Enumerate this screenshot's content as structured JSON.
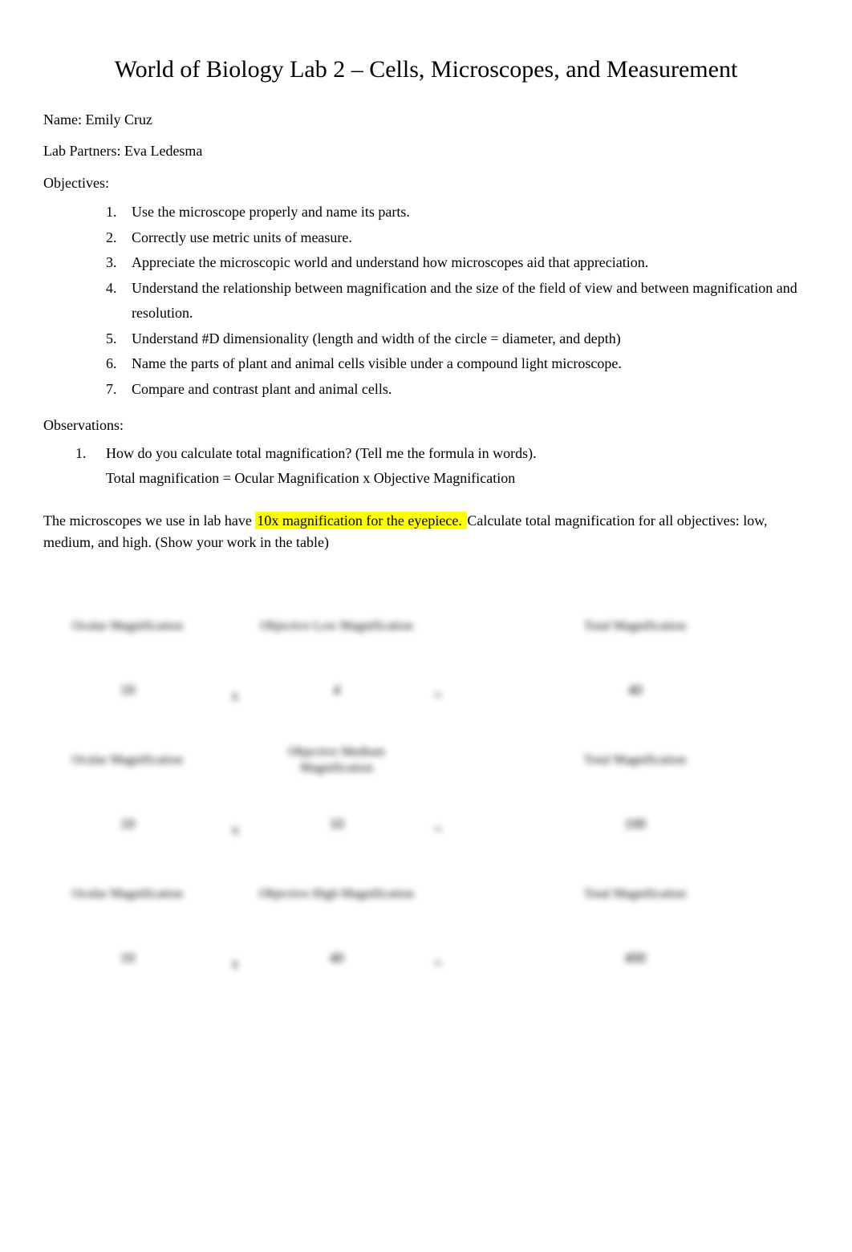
{
  "title": "World of Biology Lab 2 – Cells, Microscopes, and Measurement",
  "name_label": "Name: ",
  "name_value": "Emily Cruz",
  "partners_label": "Lab Partners: ",
  "partners_value": "Eva Ledesma",
  "objectives_heading": "Objectives:",
  "objectives": [
    "Use the microscope properly and name its parts.",
    "Correctly use metric units of measure.",
    "Appreciate the microscopic world and understand how microscopes aid that appreciation.",
    "Understand the relationship between magnification and the size of the field of view and between magnification and resolution.",
    "Understand #D dimensionality (length and width of the circle = diameter, and depth)",
    "Name the parts of plant and animal cells visible under a compound light microscope.",
    "Compare and contrast plant and animal cells."
  ],
  "observations_heading": "Observations:",
  "observation_number": "1.",
  "observation_question": "How do you calculate total magnification? (Tell me the formula in words).",
  "observation_answer": "Total magnification = Ocular Magnification x Objective Magnification",
  "paragraph_before_highlight": "The microscopes we use in lab have ",
  "highlight_text": "10x magnification for the eyepiece. ",
  "paragraph_after_highlight": "Calculate total magnification for all objectives: low, medium, and high. (Show your work in the table)",
  "table": {
    "ocular_header": "Ocular Magnification",
    "total_header": "Total Magnification",
    "objective_low_header": "Objective Low Magnification",
    "objective_medium_header": "Objective Medium Magnification",
    "objective_high_header": "Objective High Magnification",
    "multiply_symbol": "x",
    "equals_symbol": "=",
    "rows": [
      {
        "ocular": "10",
        "objective": "4",
        "total": "40"
      },
      {
        "ocular": "10",
        "objective": "10",
        "total": "100"
      },
      {
        "ocular": "10",
        "objective": "40",
        "total": "400"
      }
    ]
  }
}
